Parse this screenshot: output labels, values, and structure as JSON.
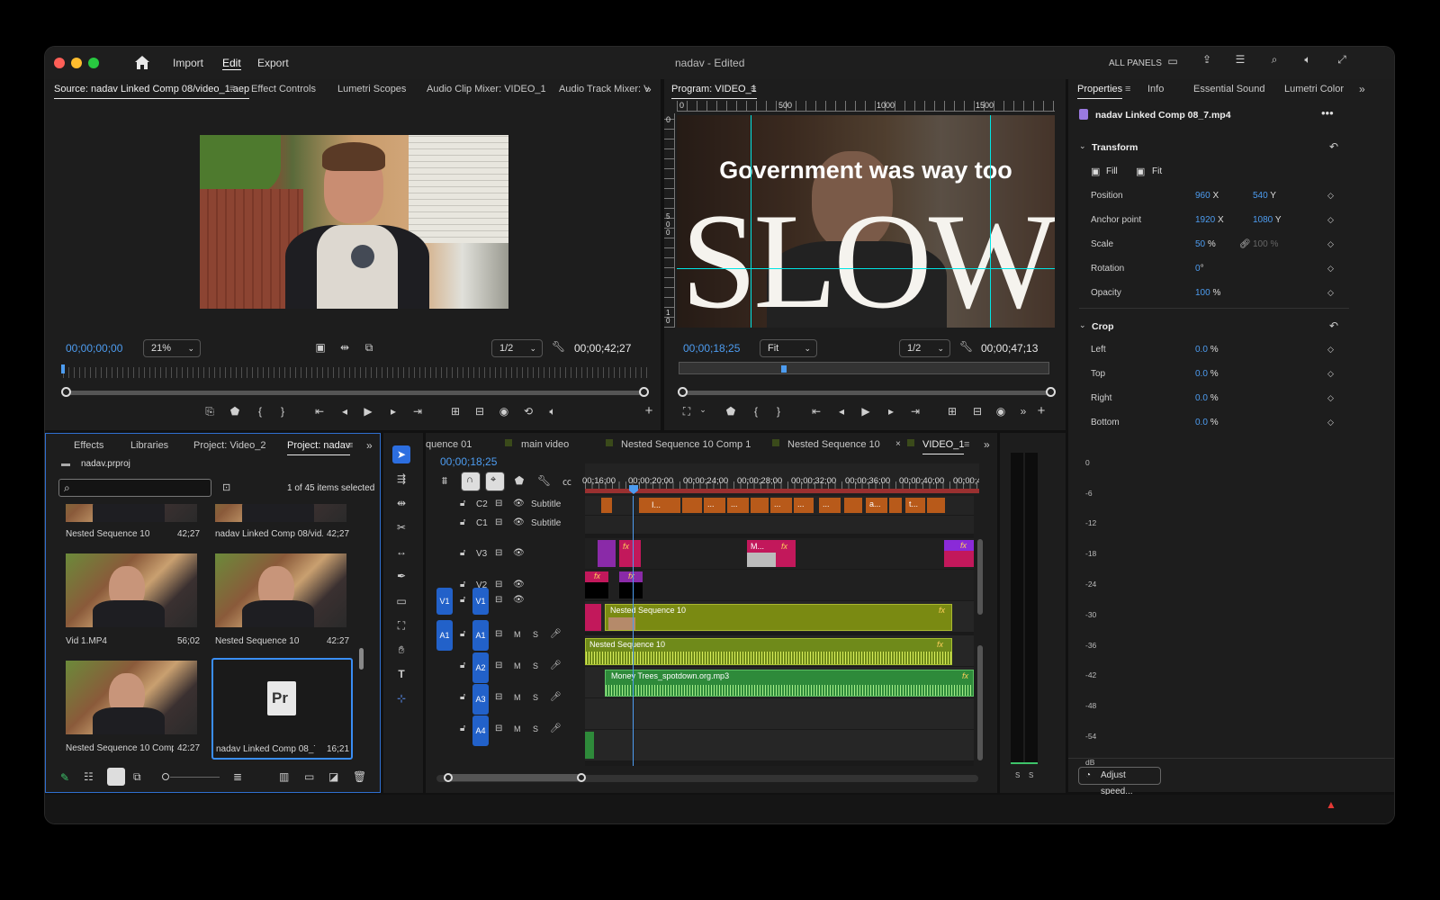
{
  "app": {
    "title": "nadav - Edited",
    "nav": [
      "Import",
      "Edit",
      "Export"
    ],
    "all_panels": "ALL PANELS"
  },
  "source": {
    "tabs": [
      "Source: nadav Linked Comp 08/video_1.aep",
      "Effect Controls",
      "Lumetri Scopes",
      "Audio Clip Mixer: VIDEO_1",
      "Audio Track Mixer: VII"
    ],
    "timecode": "00;00;00;00",
    "zoom": "21%",
    "quality": "1/2",
    "duration": "00;00;42;27"
  },
  "program": {
    "tab": "Program: VIDEO_1",
    "ruler": [
      "0",
      "500",
      "1000",
      "1500"
    ],
    "vruler": [
      "0",
      "5\n0\n0",
      "1\n0"
    ],
    "overlay_line1": "Government was way too",
    "overlay_line2": "SLOW",
    "timecode": "00;00;18;25",
    "fit": "Fit",
    "quality": "1/2",
    "duration": "00;00;47;13"
  },
  "properties": {
    "tabs": [
      "Properties",
      "Info",
      "Essential Sound",
      "Lumetri Color"
    ],
    "clip_name": "nadav Linked Comp 08_7.mp4",
    "transform_label": "Transform",
    "fill": "Fill",
    "fit": "Fit",
    "rows": [
      {
        "k": "Position",
        "v1": "960",
        "u1": "X",
        "v2": "540",
        "u2": "Y"
      },
      {
        "k": "Anchor point",
        "v1": "1920",
        "u1": "X",
        "v2": "1080",
        "u2": "Y"
      },
      {
        "k": "Scale",
        "v1": "50",
        "u1": "%",
        "v2": "100 %",
        "u2": ""
      },
      {
        "k": "Rotation",
        "v1": "0",
        "u1": "°",
        "v2": "",
        "u2": ""
      },
      {
        "k": "Opacity",
        "v1": "100",
        "u1": "%",
        "v2": "",
        "u2": ""
      }
    ],
    "crop_label": "Crop",
    "crop": [
      {
        "k": "Left",
        "v": "0.0",
        "u": "%"
      },
      {
        "k": "Top",
        "v": "0.0",
        "u": "%"
      },
      {
        "k": "Right",
        "v": "0.0",
        "u": "%"
      },
      {
        "k": "Bottom",
        "v": "0.0",
        "u": "%"
      }
    ],
    "adjust_speed": "Adjust speed..."
  },
  "project": {
    "tabs": [
      "Effects",
      "Libraries",
      "Project: Video_2",
      "Project: nadav"
    ],
    "file": "nadav.prproj",
    "search_placeholder": "",
    "selected": "1 of 45 items selected",
    "items": [
      {
        "name": "Nested Sequence 10",
        "dur": "42;27"
      },
      {
        "name": "nadav Linked Comp 08/vid...",
        "dur": "42;27"
      },
      {
        "name": "Vid 1.MP4",
        "dur": "56;02"
      },
      {
        "name": "Nested Sequence 10",
        "dur": "42:27"
      },
      {
        "name": "Nested Sequence 10 Comp 1",
        "dur": "42:27"
      },
      {
        "name": "nadav Linked Comp 08_7...",
        "dur": "16;21"
      }
    ],
    "pr_glyph": "Pr"
  },
  "timeline": {
    "tabs": [
      "quence 01",
      "main video",
      "Nested Sequence 10 Comp 1",
      "Nested Sequence 10",
      "VIDEO_1"
    ],
    "timecode": "00;00;18;25",
    "ruler": [
      "00;16;00",
      "00;00;20;00",
      "00;00;24;00",
      "00;00;28;00",
      "00;00;32;00",
      "00;00;36;00",
      "00;00;40;00",
      "00;00;4"
    ],
    "tracks": [
      {
        "id": "C2",
        "label": "Subtitle"
      },
      {
        "id": "C1",
        "label": "Subtitle"
      },
      {
        "id": "V3",
        "label": ""
      },
      {
        "id": "V2",
        "label": ""
      },
      {
        "id": "V1",
        "label": ""
      },
      {
        "id": "A1",
        "label": ""
      },
      {
        "id": "A2",
        "label": ""
      },
      {
        "id": "A3",
        "label": ""
      },
      {
        "id": "A4",
        "label": ""
      }
    ],
    "src_v1": "V1",
    "src_a1": "A1",
    "m": "M",
    "s": "S",
    "subtitle_texts": [
      "I...",
      "...",
      "...",
      "...",
      "...",
      "...",
      "a...",
      "t..."
    ],
    "clip_v3": "M...",
    "clip_v1": "Nested Sequence 10",
    "clip_a1": "Nested Sequence 10",
    "clip_a2": "Money Trees_spotdown.org.mp3",
    "fx": "fx"
  },
  "meter": {
    "ticks": [
      "0",
      "-6",
      "-12",
      "-18",
      "-24",
      "-30",
      "-36",
      "-42",
      "-48",
      "-54",
      "dB"
    ],
    "s": "S"
  }
}
